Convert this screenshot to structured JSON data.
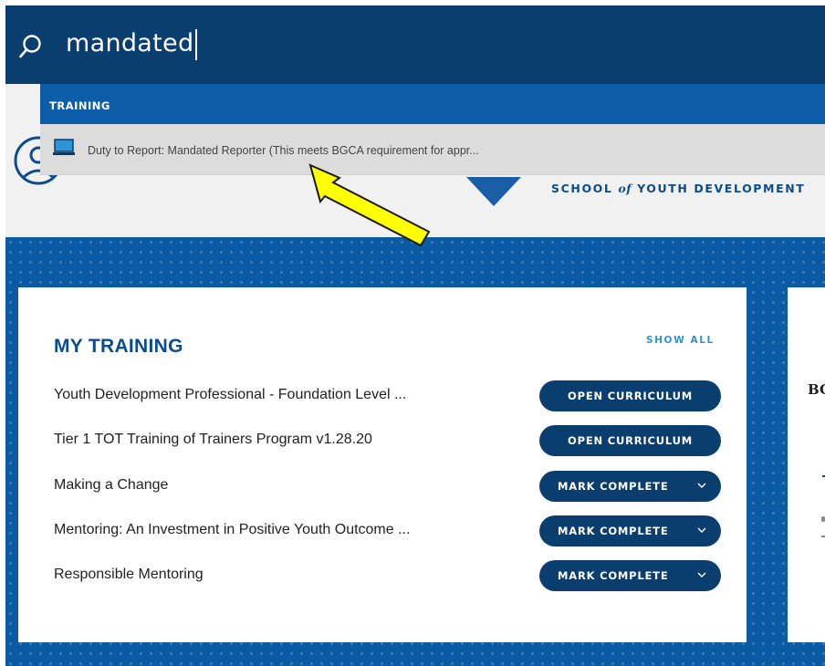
{
  "search": {
    "query": "mandated"
  },
  "dropdown": {
    "section_label": "TRAINING",
    "results": [
      {
        "icon": "laptop-icon",
        "label": "Duty to Report: Mandated Reporter (This meets BGCA requirement for appr..."
      }
    ]
  },
  "header": {
    "logo": {
      "text_before": "SCHOOL",
      "text_of": "of",
      "text_after": "YOUTH DEVELOPMENT"
    }
  },
  "my_training": {
    "title": "MY TRAINING",
    "show_all": "SHOW ALL",
    "items": [
      {
        "label": "Youth Development Professional - Foundation Level ...",
        "action": "OPEN CURRICULUM",
        "has_menu": false
      },
      {
        "label": "Tier 1 TOT Training of Trainers Program v1.28.20",
        "action": "OPEN CURRICULUM",
        "has_menu": false
      },
      {
        "label": "Making a Change",
        "action": "MARK COMPLETE",
        "has_menu": true
      },
      {
        "label": "Mentoring: An Investment in Positive Youth Outcome ...",
        "action": "MARK COMPLETE",
        "has_menu": true
      },
      {
        "label": "Responsible Mentoring",
        "action": "MARK COMPLETE",
        "has_menu": true
      }
    ]
  },
  "side_card": {
    "text": "BC"
  },
  "colors": {
    "search_bar": "#0a3e6f",
    "dropdown_header": "#0d5da8",
    "brand_blue": "#0b5aa4",
    "button": "#0a3e6f",
    "link": "#2f94d6",
    "annotation_arrow": "#ffff00"
  }
}
